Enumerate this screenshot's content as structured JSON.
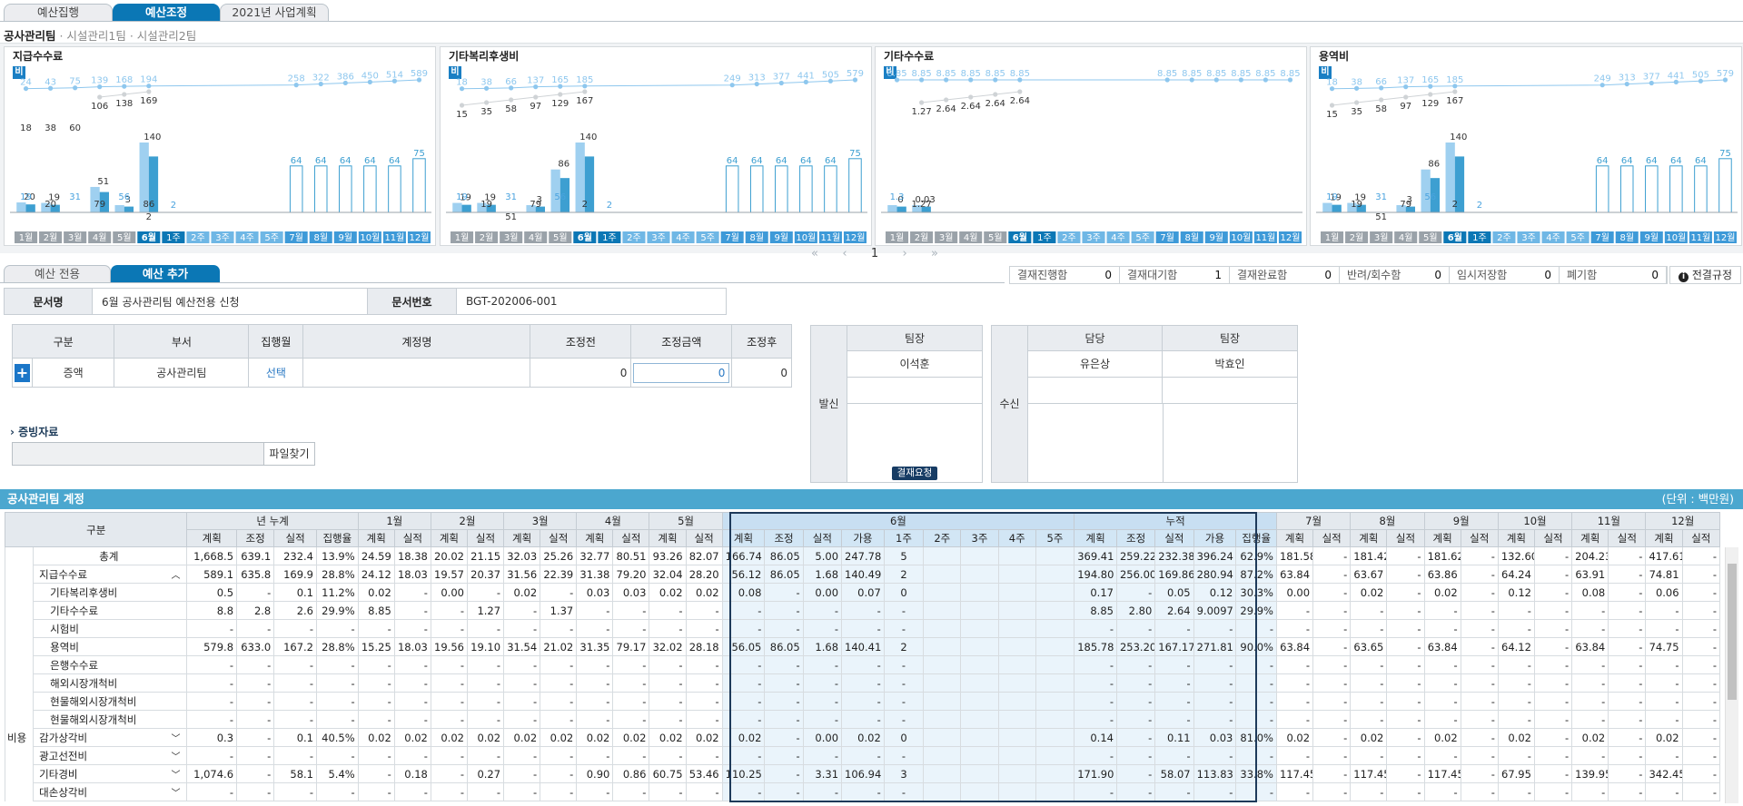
{
  "top_tabs": [
    "예산집행",
    "예산조정",
    "2021년 사업계획"
  ],
  "team_line": {
    "main": "공사관리팀",
    "sub": " · 시설관리1팀 · 시설관리2팀"
  },
  "charts": [
    {
      "title": "지급수수료",
      "badge": "비",
      "x_labels": [
        "1월",
        "2월",
        "3월",
        "4월",
        "5월",
        "6월",
        "1주",
        "2주",
        "3주",
        "4주",
        "5주",
        "7월",
        "8월",
        "9월",
        "10월",
        "11월",
        "12월"
      ],
      "line_top": [
        "24",
        "43",
        "75",
        "139",
        "168",
        "194",
        "",
        "",
        "",
        "",
        "",
        "258",
        "322",
        "386",
        "450",
        "514",
        "589"
      ],
      "line_mid": [
        "",
        "",
        "",
        "106",
        "138",
        "169",
        "",
        "",
        "",
        "",
        "",
        "",
        "",
        "",
        "",
        "",
        ""
      ],
      "gray_labels": [
        "18",
        "38",
        "60",
        "",
        "",
        "",
        "",
        "",
        "",
        "",
        "",
        "",
        "",
        "",
        "",
        "",
        ""
      ],
      "bar_labels": [
        "20",
        "19",
        "",
        "51",
        "3",
        "140",
        "",
        "",
        "",
        "",
        "",
        "64",
        "64",
        "64",
        "64",
        "64",
        "75"
      ],
      "small_labels": [
        "19",
        "20",
        "31",
        "79",
        "56",
        "86",
        "2",
        "",
        "",
        "",
        "",
        "",
        "",
        "",
        "",
        "",
        ""
      ],
      "extra": [
        "",
        "",
        "",
        "",
        "",
        "2",
        "",
        "",
        "",
        "",
        "",
        "",
        "",
        "",
        "",
        "",
        ""
      ]
    },
    {
      "title": "기타복리후생비",
      "badge": "비",
      "x_labels": [
        "1월",
        "2월",
        "3월",
        "4월",
        "5월",
        "6월",
        "1주",
        "2주",
        "3주",
        "4주",
        "5주",
        "7월",
        "8월",
        "9월",
        "10월",
        "11월",
        "12월"
      ],
      "line_top": [
        "18",
        "38",
        "66",
        "137",
        "165",
        "185",
        "",
        "",
        "",
        "",
        "",
        "249",
        "313",
        "377",
        "441",
        "505",
        "579"
      ],
      "line_mid": [
        "15",
        "35",
        "58",
        "97",
        "129",
        "167",
        "",
        "",
        "",
        "",
        "",
        "",
        "",
        "",
        "",
        "",
        ""
      ],
      "gray_labels": [
        "",
        "",
        "",
        "",
        "",
        "",
        "",
        "",
        "",
        "",
        "",
        "",
        "",
        "",
        "",
        "",
        ""
      ],
      "bar_labels": [
        "19",
        "19",
        "",
        "3",
        "86",
        "140",
        "",
        "",
        "",
        "",
        "",
        "64",
        "64",
        "64",
        "64",
        "64",
        "75"
      ],
      "small_labels": [
        "19",
        "19",
        "31",
        "79",
        "56",
        "2",
        "2",
        "",
        "",
        "",
        "",
        "",
        "",
        "",
        "",
        "",
        ""
      ],
      "extra": [
        "",
        "",
        "51",
        "",
        "",
        "",
        "",
        "",
        "",
        "",
        "",
        "",
        "",
        "",
        "",
        "",
        ""
      ]
    },
    {
      "title": "기타수수료",
      "badge": "비",
      "x_labels": [
        "1월",
        "2월",
        "3월",
        "4월",
        "5월",
        "6월",
        "1주",
        "2주",
        "3주",
        "4주",
        "5주",
        "7월",
        "8월",
        "9월",
        "10월",
        "11월",
        "12월"
      ],
      "line_top": [
        "8.85",
        "8.85",
        "8.85",
        "8.85",
        "8.85",
        "8.85",
        "",
        "",
        "",
        "",
        "",
        "8.85",
        "8.85",
        "8.85",
        "8.85",
        "8.85",
        "8.85"
      ],
      "line_mid": [
        "",
        "1.27",
        "2.64",
        "2.64",
        "2.64",
        "2.64",
        "",
        "",
        "",
        "",
        "",
        "",
        "",
        "",
        "",
        "",
        ""
      ],
      "gray_labels": [
        "",
        "",
        "",
        "",
        "",
        "",
        "",
        "",
        "",
        "",
        "",
        "",
        "",
        "",
        "",
        "",
        ""
      ],
      "bar_labels": [
        "0",
        "0.03",
        "",
        "",
        "",
        "",
        "",
        "",
        "",
        "",
        "",
        "",
        "",
        "",
        "",
        "",
        ""
      ],
      "small_labels": [
        "1.3",
        "1.27",
        "",
        "",
        "",
        "",
        "",
        "",
        "",
        "",
        "",
        "",
        "",
        "",
        "",
        "",
        ""
      ],
      "extra": [
        "",
        "",
        "",
        "",
        "",
        "",
        "",
        "",
        "",
        "",
        "",
        "",
        "",
        "",
        "",
        "",
        ""
      ]
    },
    {
      "title": "용역비",
      "badge": "비",
      "x_labels": [
        "1월",
        "2월",
        "3월",
        "4월",
        "5월",
        "6월",
        "1주",
        "2주",
        "3주",
        "4주",
        "5주",
        "7월",
        "8월",
        "9월",
        "10월",
        "11월",
        "12월"
      ],
      "line_top": [
        "18",
        "38",
        "66",
        "137",
        "165",
        "185",
        "",
        "",
        "",
        "",
        "",
        "249",
        "313",
        "377",
        "441",
        "505",
        "579"
      ],
      "line_mid": [
        "15",
        "35",
        "58",
        "97",
        "129",
        "167",
        "",
        "",
        "",
        "",
        "",
        "",
        "",
        "",
        "",
        "",
        ""
      ],
      "gray_labels": [
        "",
        "",
        "",
        "",
        "",
        "",
        "",
        "",
        "",
        "",
        "",
        "",
        "",
        "",
        "",
        "",
        ""
      ],
      "bar_labels": [
        "19",
        "19",
        "",
        "3",
        "86",
        "140",
        "",
        "",
        "",
        "",
        "",
        "64",
        "64",
        "64",
        "64",
        "64",
        "75"
      ],
      "small_labels": [
        "19",
        "19",
        "31",
        "79",
        "56",
        "2",
        "2",
        "",
        "",
        "",
        "",
        "",
        "",
        "",
        "",
        "",
        ""
      ],
      "extra": [
        "",
        "",
        "51",
        "",
        "",
        "",
        "",
        "",
        "",
        "",
        "",
        "",
        "",
        "",
        "",
        "",
        ""
      ]
    }
  ],
  "pager": {
    "first": "«",
    "prev": "‹",
    "page": "1",
    "next": "›",
    "last": "»"
  },
  "bottom_tabs": [
    "예산 전용",
    "예산 추가"
  ],
  "status": [
    {
      "label": "결재진행함",
      "count": "0"
    },
    {
      "label": "결재대기함",
      "count": "1"
    },
    {
      "label": "결재완료함",
      "count": "0"
    },
    {
      "label": "반려/회수함",
      "count": "0"
    },
    {
      "label": "임시저장함",
      "count": "0"
    },
    {
      "label": "폐기함",
      "count": "0"
    }
  ],
  "rule_link": "전결규정",
  "doc": {
    "name_label": "문서명",
    "name_value": "6월 공사관리팀 예산전용 신청",
    "no_label": "문서번호",
    "no_value": "BGT-202006-001"
  },
  "adjust": {
    "headers": [
      "구분",
      "부서",
      "집행월",
      "계정명",
      "조정전",
      "조정금액",
      "조정후"
    ],
    "add_btn": "+",
    "row": {
      "type": "증액",
      "dept": "공사관리팀",
      "month": "선택",
      "account": "",
      "before": "0",
      "amount": "0",
      "after": "0"
    }
  },
  "evidence": {
    "label": "증빙자료",
    "file_btn": "파일찾기"
  },
  "send": {
    "label": "발신",
    "role": "팀장",
    "name": "이석훈",
    "request_btn": "결재요청"
  },
  "recv": {
    "label": "수신",
    "roles": [
      "담당",
      "팀장"
    ],
    "names": [
      "유은상",
      "박효인"
    ]
  },
  "account_section": {
    "title": "공사관리팀 계정",
    "unit": "(단위 : 백만원)"
  },
  "table": {
    "group_header": "구분",
    "side_label": "비용",
    "year_header": "년 누계",
    "year_cols": [
      "계획",
      "조정",
      "실적",
      "집행율"
    ],
    "months_before": [
      "1월",
      "2월",
      "3월",
      "4월",
      "5월"
    ],
    "pair_cols": [
      "계획",
      "실적"
    ],
    "june_header": "6월",
    "june_cols": [
      "계획",
      "조정",
      "실적",
      "가용",
      "1주",
      "2주",
      "3주",
      "4주",
      "5주"
    ],
    "cum_header": "누적",
    "cum_cols": [
      "계획",
      "조정",
      "실적",
      "가용",
      "집행율"
    ],
    "months_after": [
      "7월",
      "8월",
      "9월",
      "10월",
      "11월",
      "12월"
    ],
    "rows": [
      {
        "name": "총계",
        "chev": "",
        "c": [
          "1,668.5",
          "639.1",
          "232.4",
          "13.9%",
          "24.59",
          "18.38",
          "20.02",
          "21.15",
          "32.03",
          "25.26",
          "32.77",
          "80.51",
          "93.26",
          "82.07",
          "166.74",
          "86.05",
          "5.00",
          "247.78",
          "5",
          "",
          "",
          "",
          "",
          "369.41",
          "259.22",
          "232.38",
          "396.24",
          "62.9%",
          "181.58",
          "-",
          "181.42",
          "-",
          "181.62",
          "-",
          "132.60",
          "-",
          "204.23",
          "-",
          "417.61",
          "-"
        ]
      },
      {
        "name": "지급수수료",
        "chev": "^",
        "c": [
          "589.1",
          "635.8",
          "169.9",
          "28.8%",
          "24.12",
          "18.03",
          "19.57",
          "20.37",
          "31.56",
          "22.39",
          "31.38",
          "79.20",
          "32.04",
          "28.20",
          "56.12",
          "86.05",
          "1.68",
          "140.49",
          "2",
          "",
          "",
          "",
          "",
          "194.80",
          "256.00",
          "169.86",
          "280.94",
          "87.2%",
          "63.84",
          "-",
          "63.67",
          "-",
          "63.86",
          "-",
          "64.24",
          "-",
          "63.91",
          "-",
          "74.81",
          "-"
        ]
      },
      {
        "name": "기타복리후생비",
        "chev": "",
        "c": [
          "0.5",
          "-",
          "0.1",
          "11.2%",
          "0.02",
          "-",
          "0.00",
          "-",
          "0.02",
          "-",
          "0.03",
          "0.03",
          "0.02",
          "0.02",
          "0.08",
          "-",
          "0.00",
          "0.07",
          "0",
          "",
          "",
          "",
          "",
          "0.17",
          "-",
          "0.05",
          "0.12",
          "30.3%",
          "0.00",
          "-",
          "0.02",
          "-",
          "0.02",
          "-",
          "0.12",
          "-",
          "0.08",
          "-",
          "0.06",
          "-"
        ]
      },
      {
        "name": "기타수수료",
        "chev": "",
        "c": [
          "8.8",
          "2.8",
          "2.6",
          "29.9%",
          "8.85",
          "-",
          "-",
          "1.27",
          "-",
          "1.37",
          "-",
          "-",
          "-",
          "-",
          "-",
          "-",
          "-",
          "-",
          "-",
          "",
          "",
          "",
          "",
          "8.85",
          "2.80",
          "2.64",
          "9.0097",
          "29.9%",
          "-",
          "-",
          "-",
          "-",
          "-",
          "-",
          "-",
          "-",
          "-",
          "-",
          "-",
          "-"
        ]
      },
      {
        "name": "시험비",
        "chev": "",
        "c": [
          "-",
          "-",
          "-",
          "-",
          "-",
          "-",
          "-",
          "-",
          "-",
          "-",
          "-",
          "-",
          "-",
          "-",
          "-",
          "-",
          "-",
          "-",
          "-",
          "",
          "",
          "",
          "",
          "-",
          "-",
          "-",
          "-",
          "-",
          "-",
          "-",
          "-",
          "-",
          "-",
          "-",
          "-",
          "-",
          "-",
          "-",
          "-",
          "-"
        ]
      },
      {
        "name": "용역비",
        "chev": "",
        "c": [
          "579.8",
          "633.0",
          "167.2",
          "28.8%",
          "15.25",
          "18.03",
          "19.56",
          "19.10",
          "31.54",
          "21.02",
          "31.35",
          "79.17",
          "32.02",
          "28.18",
          "56.05",
          "86.05",
          "1.68",
          "140.41",
          "2",
          "",
          "",
          "",
          "",
          "185.78",
          "253.20",
          "167.17",
          "271.81",
          "90.0%",
          "63.84",
          "-",
          "63.65",
          "-",
          "63.84",
          "-",
          "64.12",
          "-",
          "63.84",
          "-",
          "74.75",
          "-"
        ]
      },
      {
        "name": "은행수수료",
        "chev": "",
        "c": [
          "-",
          "-",
          "-",
          "-",
          "-",
          "-",
          "-",
          "-",
          "-",
          "-",
          "-",
          "-",
          "-",
          "-",
          "-",
          "-",
          "-",
          "-",
          "-",
          "",
          "",
          "",
          "",
          "-",
          "-",
          "-",
          "-",
          "-",
          "-",
          "-",
          "-",
          "-",
          "-",
          "-",
          "-",
          "-",
          "-",
          "-",
          "-",
          "-"
        ]
      },
      {
        "name": "해외시장개척비",
        "chev": "",
        "c": [
          "-",
          "-",
          "-",
          "-",
          "-",
          "-",
          "-",
          "-",
          "-",
          "-",
          "-",
          "-",
          "-",
          "-",
          "-",
          "-",
          "-",
          "-",
          "-",
          "",
          "",
          "",
          "",
          "-",
          "-",
          "-",
          "-",
          "-",
          "-",
          "-",
          "-",
          "-",
          "-",
          "-",
          "-",
          "-",
          "-",
          "-",
          "-",
          "-"
        ]
      },
      {
        "name": "현물해외시장개척비",
        "chev": "",
        "c": [
          "-",
          "-",
          "-",
          "-",
          "-",
          "-",
          "-",
          "-",
          "-",
          "-",
          "-",
          "-",
          "-",
          "-",
          "-",
          "-",
          "-",
          "-",
          "-",
          "",
          "",
          "",
          "",
          "-",
          "-",
          "-",
          "-",
          "-",
          "-",
          "-",
          "-",
          "-",
          "-",
          "-",
          "-",
          "-",
          "-",
          "-",
          "-",
          "-"
        ]
      },
      {
        "name": "현물해외시장개척비",
        "chev": "",
        "c": [
          "-",
          "-",
          "-",
          "-",
          "-",
          "-",
          "-",
          "-",
          "-",
          "-",
          "-",
          "-",
          "-",
          "-",
          "-",
          "-",
          "-",
          "-",
          "-",
          "",
          "",
          "",
          "",
          "-",
          "-",
          "-",
          "-",
          "-",
          "-",
          "-",
          "-",
          "-",
          "-",
          "-",
          "-",
          "-",
          "-",
          "-",
          "-",
          "-"
        ]
      },
      {
        "name": "감가상각비",
        "chev": "v",
        "c": [
          "0.3",
          "-",
          "0.1",
          "40.5%",
          "0.02",
          "0.02",
          "0.02",
          "0.02",
          "0.02",
          "0.02",
          "0.02",
          "0.02",
          "0.02",
          "0.02",
          "0.02",
          "-",
          "0.00",
          "0.02",
          "0",
          "",
          "",
          "",
          "",
          "0.14",
          "-",
          "0.11",
          "0.03",
          "81.0%",
          "0.02",
          "-",
          "0.02",
          "-",
          "0.02",
          "-",
          "0.02",
          "-",
          "0.02",
          "-",
          "0.02",
          "-"
        ]
      },
      {
        "name": "광고선전비",
        "chev": "v",
        "c": [
          "-",
          "-",
          "-",
          "-",
          "-",
          "-",
          "-",
          "-",
          "-",
          "-",
          "-",
          "-",
          "-",
          "-",
          "-",
          "-",
          "-",
          "-",
          "-",
          "",
          "",
          "",
          "",
          "-",
          "-",
          "-",
          "-",
          "-",
          "-",
          "-",
          "-",
          "-",
          "-",
          "-",
          "-",
          "-",
          "-",
          "-",
          "-",
          "-"
        ]
      },
      {
        "name": "기타경비",
        "chev": "v",
        "c": [
          "1,074.6",
          "-",
          "58.1",
          "5.4%",
          "-",
          "0.18",
          "-",
          "0.27",
          "-",
          "-",
          "0.90",
          "0.86",
          "60.75",
          "53.46",
          "110.25",
          "-",
          "3.31",
          "106.94",
          "3",
          "",
          "",
          "",
          "",
          "171.90",
          "-",
          "58.07",
          "113.83",
          "33.8%",
          "117.45",
          "-",
          "117.45",
          "-",
          "117.45",
          "-",
          "67.95",
          "-",
          "139.95",
          "-",
          "342.45",
          "-"
        ]
      },
      {
        "name": "대손상각비",
        "chev": "v",
        "c": [
          "-",
          "-",
          "-",
          "-",
          "-",
          "-",
          "-",
          "-",
          "-",
          "-",
          "-",
          "-",
          "-",
          "-",
          "-",
          "-",
          "-",
          "-",
          "-",
          "",
          "",
          "",
          "",
          "-",
          "-",
          "-",
          "-",
          "-",
          "-",
          "-",
          "-",
          "-",
          "-",
          "-",
          "-",
          "-",
          "-",
          "-",
          "-",
          "-"
        ]
      }
    ]
  },
  "colors": {
    "accent": "#0b77b5",
    "section": "#4ba7cf",
    "bar_dark": "#3d9fd1",
    "bar_light": "#9fd0f0",
    "bar_gray": "#bfc4c8",
    "line": "#8ec7ee"
  }
}
